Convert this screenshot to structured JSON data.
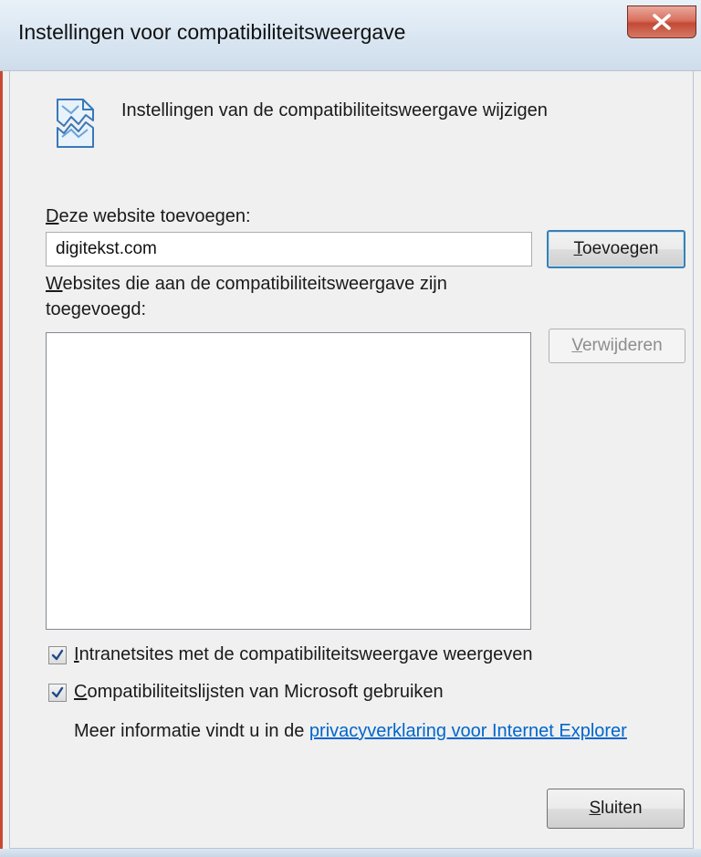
{
  "window": {
    "title": "Instellingen voor compatibiliteitsweergave",
    "close_glyph": "x"
  },
  "header": {
    "icon": "broken-page-icon",
    "text": "Instellingen van de compatibiliteitsweergave wijzigen"
  },
  "add_site": {
    "label_accel": "D",
    "label_rest": "eze website toevoegen:",
    "value": "digitekst.com",
    "button_accel": "T",
    "button_rest": "oevoegen"
  },
  "site_list": {
    "label_accel": "W",
    "label_line1_rest": "ebsites die aan de compatibiliteitsweergave zijn",
    "label_line2": "toegevoegd:",
    "items": [],
    "remove_accel": "V",
    "remove_rest": "erwijderen"
  },
  "options": [
    {
      "checked": true,
      "accel": "I",
      "rest": "ntranetsites met de compatibiliteitsweergave weergeven"
    },
    {
      "checked": true,
      "accel": "C",
      "rest": "ompatibiliteitslijsten van Microsoft gebruiken"
    }
  ],
  "info": {
    "text": "Meer informatie vindt u in de ",
    "link": "privacyverklaring voor Internet Explorer"
  },
  "footer": {
    "close_accel": "S",
    "close_rest": "luiten"
  },
  "colors": {
    "link": "#0066cc",
    "close_button": "#c24a35",
    "default_button_border": "#3c7fb1"
  }
}
